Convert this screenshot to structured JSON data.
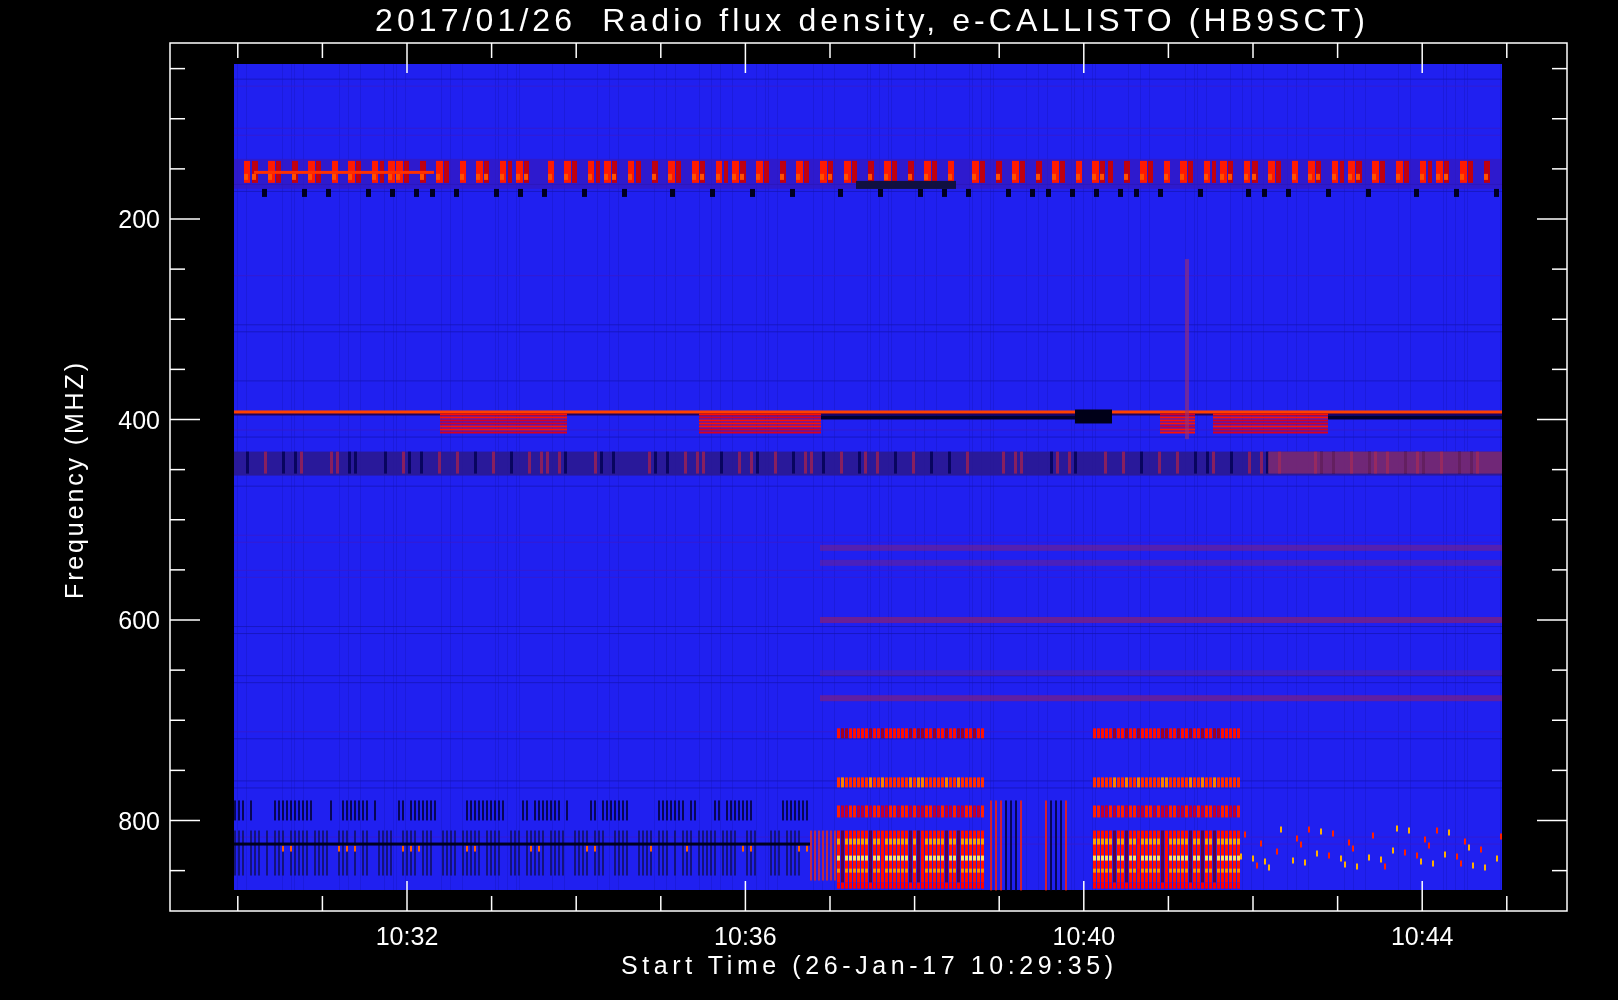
{
  "title": "2017/01/26  Radio flux density, e-CALLISTO (HB9SCT)",
  "y_axis": {
    "label": "Frequency (MHZ)",
    "tick_labels": [
      "200",
      "400",
      "600",
      "800"
    ]
  },
  "x_axis": {
    "label": "Start Time (26-Jan-17 10:29:35)",
    "tick_labels": [
      "10:32",
      "10:36",
      "10:40",
      "10:44"
    ]
  }
}
